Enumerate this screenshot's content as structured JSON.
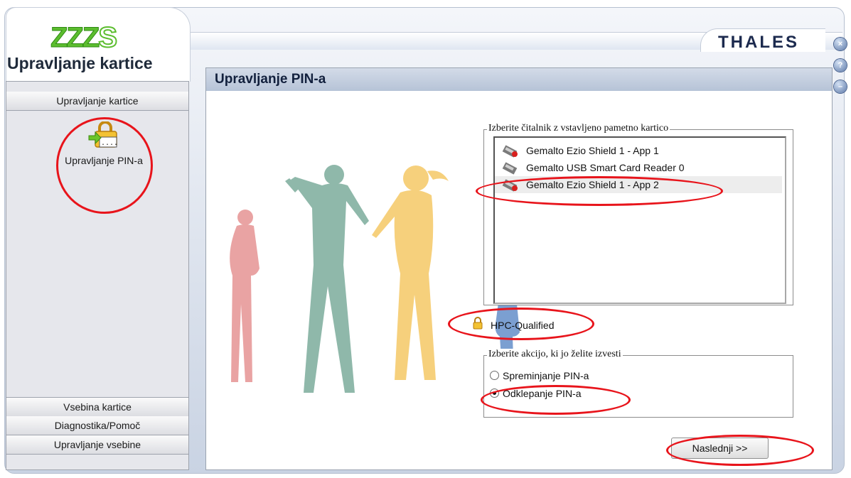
{
  "app": {
    "logo_text": "ZZZS",
    "title": "Upravljanje kartice",
    "brand": "THALES"
  },
  "window_buttons": [
    {
      "name": "close",
      "glyph": "×"
    },
    {
      "name": "help",
      "glyph": "?"
    },
    {
      "name": "minimize",
      "glyph": "–"
    }
  ],
  "sidebar": {
    "top_item": "Upravljanje kartice",
    "entry": {
      "label": "Upravljanje PIN-a",
      "icon": "lock-key-icon"
    },
    "bottom_items": [
      "Vsebina kartice",
      "Diagnostika/Pomoč",
      "Upravljanje vsebine"
    ]
  },
  "panel": {
    "title": "Upravljanje PIN-a",
    "reader_group": {
      "legend": "Izberite čitalnik z vstavljeno pametno kartico",
      "readers": [
        {
          "label": "Gemalto Ezio Shield 1 - App 1",
          "icon": "card-reader-error-icon",
          "selected": false
        },
        {
          "label": "Gemalto USB Smart Card Reader 0",
          "icon": "card-reader-icon",
          "selected": false
        },
        {
          "label": "Gemalto Ezio Shield 1 - App 2",
          "icon": "card-reader-error-icon",
          "selected": true
        }
      ]
    },
    "qualification": {
      "label": "HPC-Qualified",
      "icon": "lock-icon"
    },
    "action_group": {
      "legend": "Izberite akcijo, ki jo želite izvesti",
      "options": [
        {
          "label": "Spreminjanje PIN-a",
          "checked": false
        },
        {
          "label": "Odklepanje PIN-a",
          "checked": true
        }
      ]
    },
    "next_button": "Naslednji >>"
  },
  "colors": {
    "annotation": "#e8141b",
    "logo_green": "#5cbd2f",
    "header_blue": "#b6c3d7"
  }
}
